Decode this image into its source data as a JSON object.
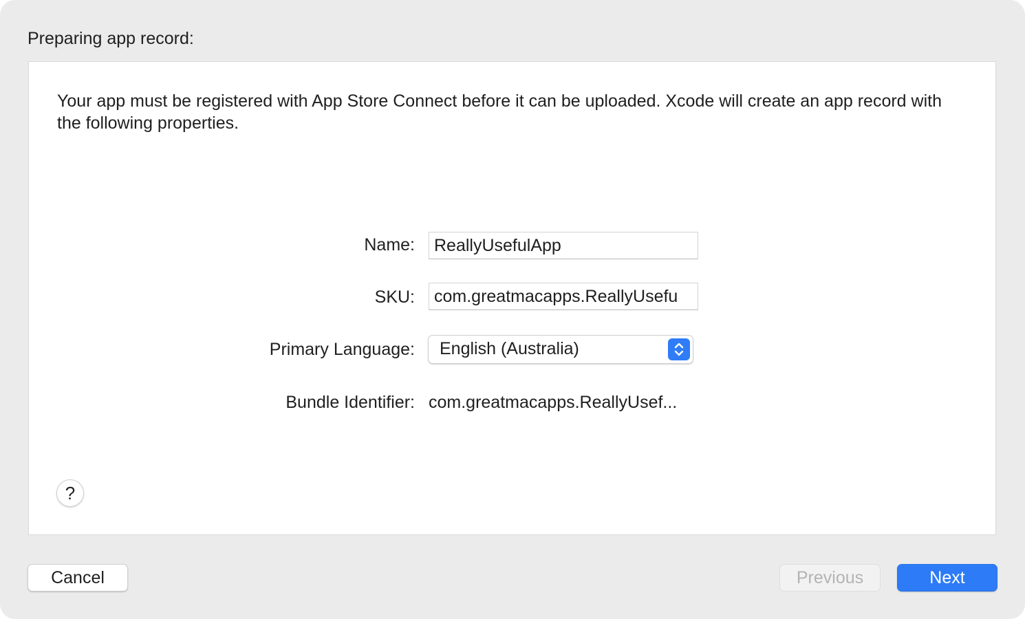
{
  "dialog": {
    "section_title": "Preparing app record:",
    "intro_text": "Your app must be registered with App Store Connect before it can be uploaded. Xcode will create an app record with the following properties."
  },
  "form": {
    "name": {
      "label": "Name:",
      "value": "ReallyUsefulApp"
    },
    "sku": {
      "label": "SKU:",
      "value": "com.greatmacapps.ReallyUsefu"
    },
    "primary_language": {
      "label": "Primary Language:",
      "value": "English (Australia)"
    },
    "bundle_identifier": {
      "label": "Bundle Identifier:",
      "value": "com.greatmacapps.ReallyUsef..."
    }
  },
  "help": {
    "label": "?"
  },
  "buttons": {
    "cancel": "Cancel",
    "previous": "Previous",
    "next": "Next"
  },
  "colors": {
    "accent": "#2d7bf6",
    "sheet_background": "#ebebeb",
    "panel_background": "#ffffff"
  },
  "icons": {
    "popup_arrows": "chevron-up-down-icon",
    "help": "question-mark-icon"
  }
}
